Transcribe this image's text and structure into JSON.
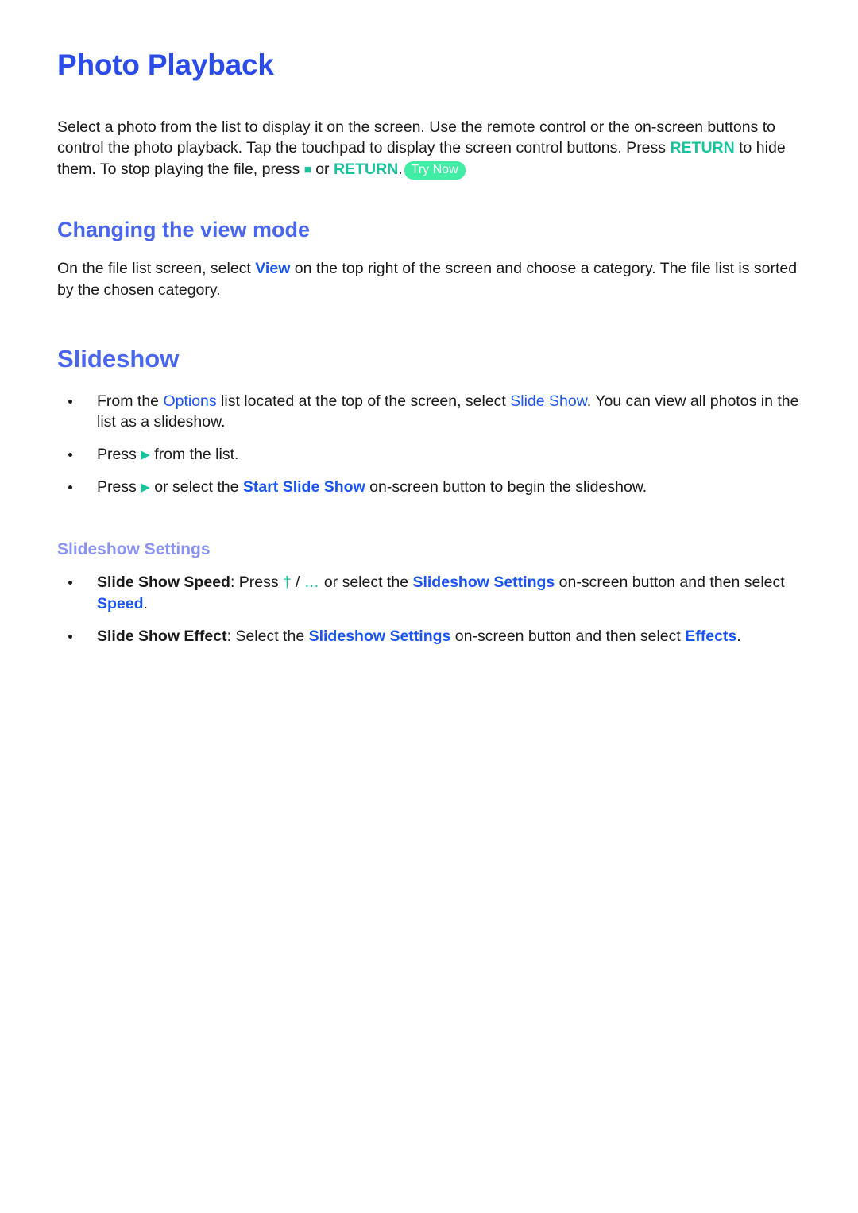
{
  "page": {
    "title": "Photo Playback",
    "accent_blue": "#2b4ce8",
    "heading_blue": "#4a66ee",
    "subheading_blue": "#8a92f2",
    "link_blue": "#1b55f0",
    "accent_teal": "#18c29a",
    "badge_green": "#41eda4"
  },
  "intro": {
    "part1": "Select a photo from the list to display it on the screen. Use the remote control or the on-screen buttons to control the photo playback. Tap the touchpad to display the screen control buttons. Press ",
    "return1": "RETURN",
    "part2": " to hide them. To stop playing the file, press ",
    "stop_icon": "■",
    "part3": " or ",
    "return2": "RETURN",
    "part4": ".",
    "badge": "Try Now"
  },
  "view_mode": {
    "heading": "Changing the view mode",
    "part1": "On the file list screen, select ",
    "link": "View",
    "part2": " on the top right of the screen and choose a category. The file list is sorted by the chosen category."
  },
  "slideshow": {
    "heading": "Slideshow",
    "bullets": [
      {
        "part1": "From the ",
        "link1": "Options",
        "part2": " list located at the top of the screen, select ",
        "link2": "Slide Show",
        "part3": ". You can view all photos in the list as a slideshow."
      },
      {
        "part1": "Press ",
        "play_icon": "▶",
        "part2": " from the list."
      },
      {
        "part1": "Press ",
        "play_icon": "▶",
        "part2": " or select the ",
        "link1": "Start Slide Show",
        "part3": " on-screen button to begin the slideshow."
      }
    ]
  },
  "slideshow_settings": {
    "heading": "Slideshow Settings",
    "bullets": [
      {
        "label": "Slide Show Speed",
        "part1": ": Press ",
        "dagger_icon": "†",
        "separator": " / ",
        "dots_icon": "…",
        "part2": " or select the ",
        "link1": "Slideshow Settings",
        "part3": " on-screen button and then select ",
        "link2": "Speed",
        "part4": "."
      },
      {
        "label": "Slide Show Effect",
        "part1": ": Select the ",
        "link1": "Slideshow Settings",
        "part2": " on-screen button and then select ",
        "link2": "Effects",
        "part3": "."
      }
    ]
  }
}
